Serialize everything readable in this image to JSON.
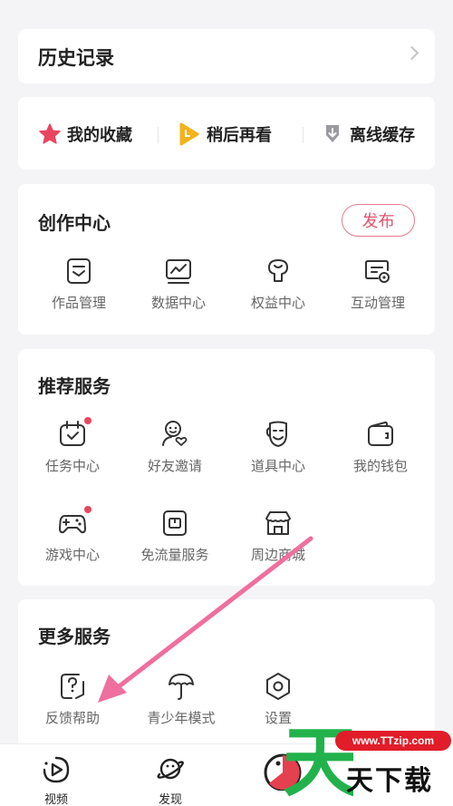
{
  "history": {
    "title": "历史记录"
  },
  "quick_actions": [
    {
      "label": "我的收藏",
      "icon": "star-icon",
      "color": "#e8465e"
    },
    {
      "label": "稍后再看",
      "icon": "play-clock-icon",
      "color": "#f5b21b"
    },
    {
      "label": "离线缓存",
      "icon": "download-icon",
      "color": "#8d8d92"
    }
  ],
  "creation": {
    "title": "创作中心",
    "publish_label": "发布",
    "items": [
      {
        "label": "作品管理",
        "icon": "works-icon"
      },
      {
        "label": "数据中心",
        "icon": "data-chart-icon"
      },
      {
        "label": "权益中心",
        "icon": "benefit-icon"
      },
      {
        "label": "互动管理",
        "icon": "interaction-icon"
      }
    ]
  },
  "recommended": {
    "title": "推荐服务",
    "items": [
      {
        "label": "任务中心",
        "icon": "calendar-check-icon",
        "badge": true
      },
      {
        "label": "好友邀请",
        "icon": "invite-friend-icon",
        "badge": false
      },
      {
        "label": "道具中心",
        "icon": "mask-icon",
        "badge": false
      },
      {
        "label": "我的钱包",
        "icon": "wallet-icon",
        "badge": false
      },
      {
        "label": "游戏中心",
        "icon": "gamepad-icon",
        "badge": true
      },
      {
        "label": "免流量服务",
        "icon": "sim-card-icon",
        "badge": false
      },
      {
        "label": "周边商城",
        "icon": "store-icon",
        "badge": false
      }
    ]
  },
  "more": {
    "title": "更多服务",
    "items": [
      {
        "label": "反馈帮助",
        "icon": "feedback-icon"
      },
      {
        "label": "青少年模式",
        "icon": "umbrella-icon"
      },
      {
        "label": "设置",
        "icon": "settings-icon"
      }
    ]
  },
  "bottom_nav": [
    {
      "label": "视频",
      "icon": "video-icon"
    },
    {
      "label": "发现",
      "icon": "planet-icon"
    }
  ],
  "watermark": {
    "site": "www.TTzip.com",
    "text": "天下载",
    "big_char": "天"
  },
  "colors": {
    "accent": "#e0546f",
    "badge": "#e8465e",
    "annotation_arrow": "#ef6f9e"
  }
}
